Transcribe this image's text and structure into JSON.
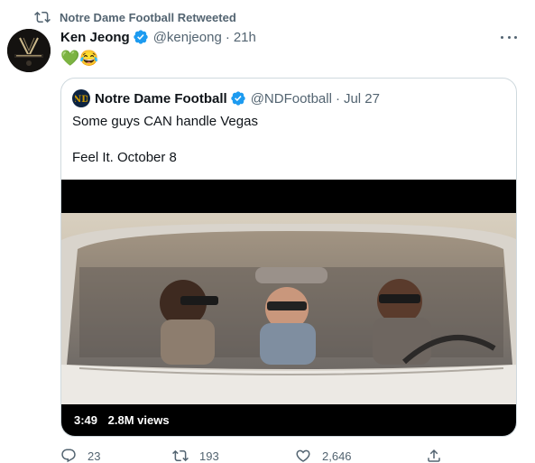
{
  "retweet": {
    "text": "Notre Dame Football Retweeted",
    "icon": "retweet-icon"
  },
  "tweet": {
    "display_name": "Ken Jeong",
    "handle": "@kenjeong",
    "separator": "·",
    "time": "21h",
    "emojis": "💚😂",
    "avatar_icon": "avatar-image"
  },
  "quote": {
    "display_name": "Notre Dame Football",
    "handle": "@NDFootball",
    "separator": "·",
    "time": "Jul 27",
    "line1": "Some guys CAN handle Vegas",
    "line2": "Feel It. October 8",
    "video": {
      "duration": "3:49",
      "views": "2.8M views"
    }
  },
  "actions": {
    "reply_count": "23",
    "retweet_count": "193",
    "like_count": "2,646"
  },
  "colors": {
    "text_primary": "#0f1419",
    "text_secondary": "#536471",
    "verified": "#1d9bf0",
    "border": "#cfd9de"
  }
}
